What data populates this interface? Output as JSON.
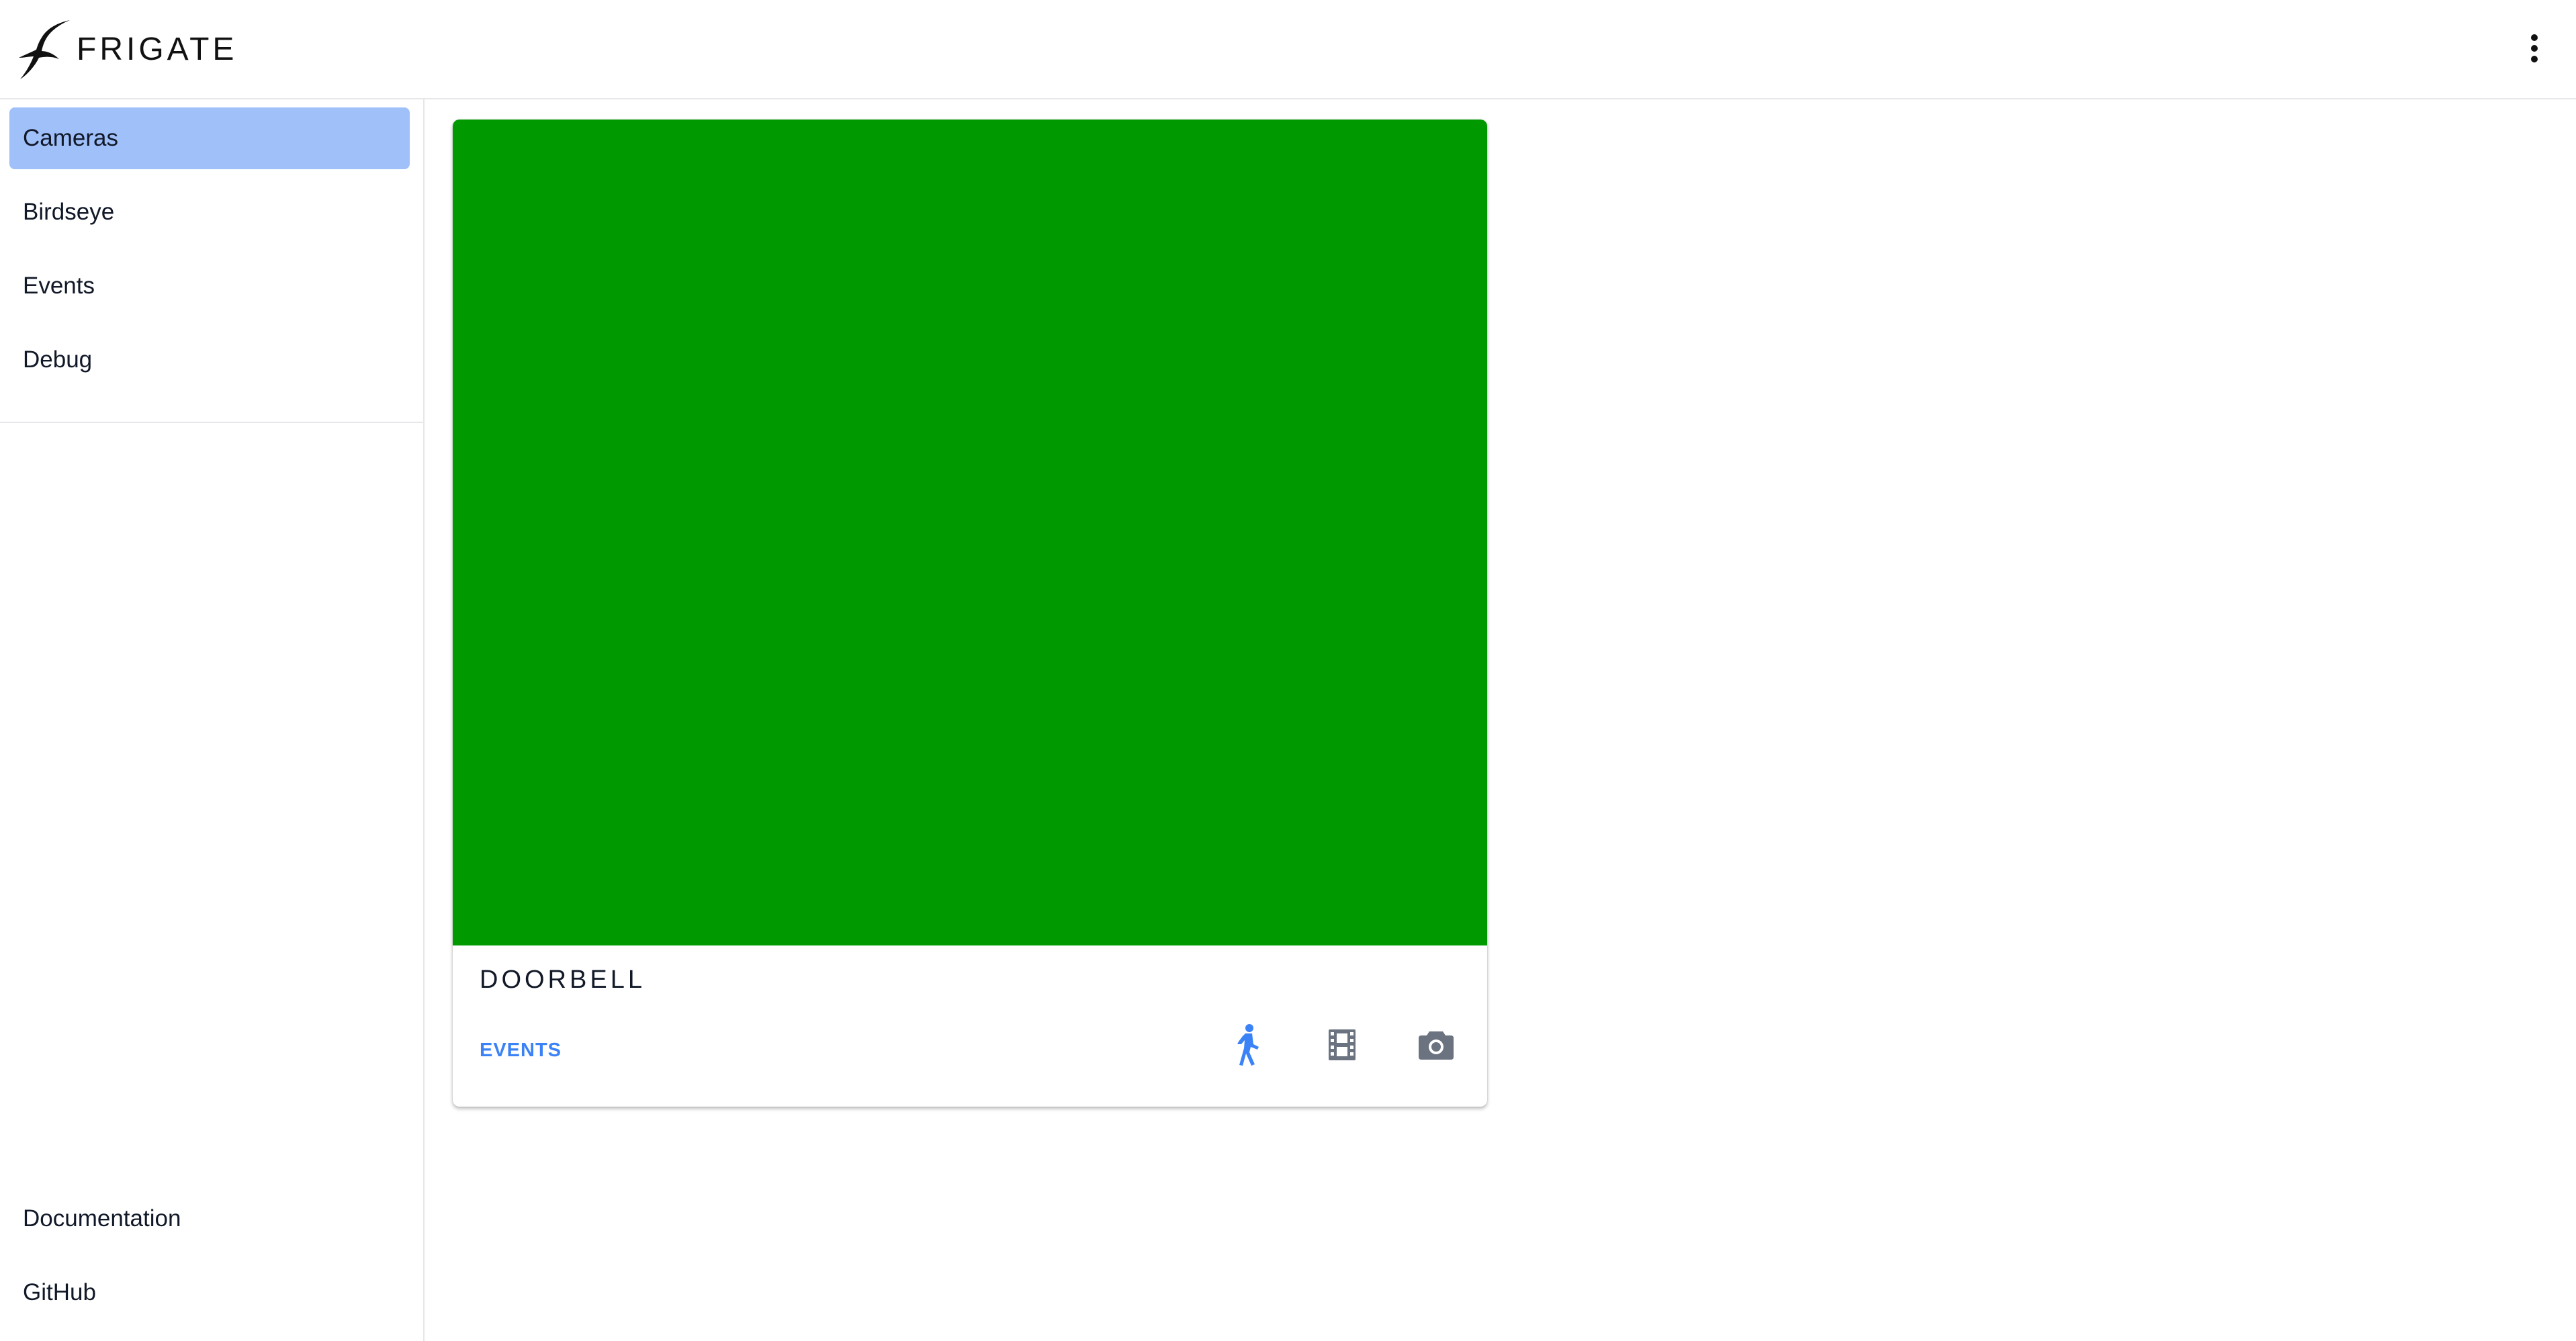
{
  "header": {
    "brand": "FRIGATE",
    "menu_icon": "more-vertical-icon",
    "logo_icon": "frigate-bird-icon"
  },
  "sidebar": {
    "primary_items": [
      {
        "label": "Cameras",
        "active": true
      },
      {
        "label": "Birdseye",
        "active": false
      },
      {
        "label": "Events",
        "active": false
      },
      {
        "label": "Debug",
        "active": false
      }
    ],
    "secondary_items": [
      {
        "label": "Documentation"
      },
      {
        "label": "GitHub"
      }
    ]
  },
  "camera_card": {
    "name": "DOORBELL",
    "events_label": "EVENTS",
    "feed_color": "#009900",
    "icons": [
      "detect-person-icon",
      "recordings-film-icon",
      "snapshot-camera-icon"
    ],
    "icon_colors": {
      "detect": "#3b82f6",
      "inactive": "#6b7280"
    }
  },
  "colors": {
    "accent": "#3b82f6",
    "active_nav": "#a0c0fa"
  }
}
